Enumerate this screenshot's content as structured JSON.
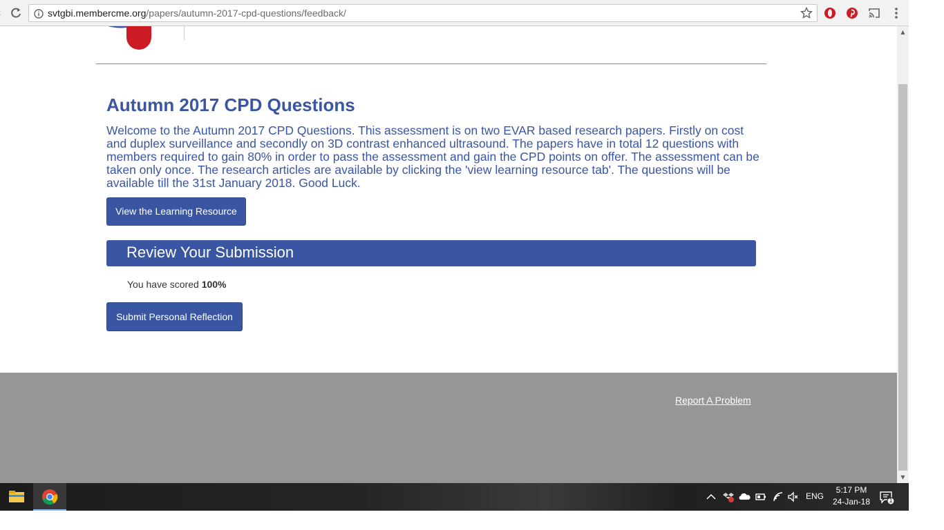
{
  "browser": {
    "url_domain": "svtgbi.membercme.org",
    "url_path": "/papers/autumn-2017-cpd-questions/feedback/"
  },
  "page": {
    "title": "Autumn 2017 CPD Questions",
    "intro": "Welcome to the Autumn 2017 CPD Questions. This assessment is on two EVAR based research papers. Firstly on cost and duplex surveillance and secondly on 3D contrast enhanced ultrasound. The papers have in total 12 questions with members required to gain 80% in order to pass the assessment and gain the CPD points on offer. The assessment can be taken only once. The research articles are available by clicking the 'view learning resource tab'. The questions will be available till the 31st January 2018. Good Luck.",
    "resource_button": "View the Learning Resource",
    "review_heading": "Review Your Submission",
    "score_prefix": "You have scored ",
    "score_value": "100%",
    "reflection_button": "Submit Personal Reflection"
  },
  "footer": {
    "report_link": "Report A Problem"
  },
  "taskbar": {
    "language": "ENG",
    "time": "5:17 PM",
    "date": "24-Jan-18",
    "notification_count": "1"
  },
  "colors": {
    "accent": "#3a56a3",
    "footer_bg": "#969696"
  },
  "icons": [
    "back-icon",
    "reload-icon",
    "info-icon",
    "star-icon",
    "opera-icon",
    "pinterest-icon",
    "cast-icon",
    "menu-icon",
    "file-explorer-icon",
    "chrome-icon",
    "tray-chevron-icon",
    "dropbox-icon",
    "onedrive-icon",
    "battery-icon",
    "wifi-icon",
    "volume-muted-icon",
    "notification-icon"
  ]
}
